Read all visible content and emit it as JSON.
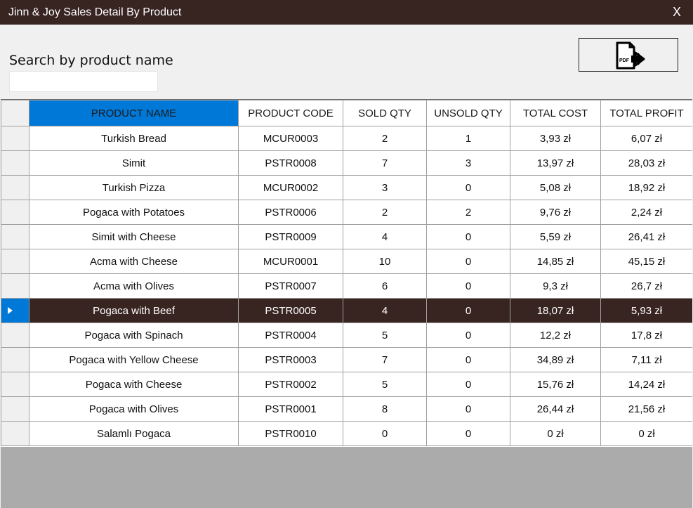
{
  "window": {
    "title": "Jinn & Joy Sales Detail By Product",
    "close_label": "X"
  },
  "search": {
    "label": "Search by product name",
    "value": "",
    "placeholder": ""
  },
  "pdf_button": {
    "icon": "pdf-export-icon",
    "icon_text": "PDF"
  },
  "colors": {
    "titlebar": "#382421",
    "header_selected": "#0078d7",
    "row_selected": "#382421",
    "empty_area": "#ababab"
  },
  "table": {
    "columns": [
      "PRODUCT NAME",
      "PRODUCT CODE",
      "SOLD QTY",
      "UNSOLD QTY",
      "TOTAL COST",
      "TOTAL PROFIT"
    ],
    "selected_row": 7,
    "rows": [
      [
        "Turkish Bread",
        "MCUR0003",
        "2",
        "1",
        "3,93 zł",
        "6,07 zł"
      ],
      [
        "Simit",
        "PSTR0008",
        "7",
        "3",
        "13,97 zł",
        "28,03 zł"
      ],
      [
        "Turkish Pizza",
        "MCUR0002",
        "3",
        "0",
        "5,08 zł",
        "18,92 zł"
      ],
      [
        "Pogaca with Potatoes",
        "PSTR0006",
        "2",
        "2",
        "9,76 zł",
        "2,24 zł"
      ],
      [
        "Simit with Cheese",
        "PSTR0009",
        "4",
        "0",
        "5,59 zł",
        "26,41 zł"
      ],
      [
        "Acma with Cheese",
        "MCUR0001",
        "10",
        "0",
        "14,85 zł",
        "45,15 zł"
      ],
      [
        "Acma with Olives",
        "PSTR0007",
        "6",
        "0",
        "9,3 zł",
        "26,7 zł"
      ],
      [
        "Pogaca with Beef",
        "PSTR0005",
        "4",
        "0",
        "18,07 zł",
        "5,93 zł"
      ],
      [
        "Pogaca with Spinach",
        "PSTR0004",
        "5",
        "0",
        "12,2 zł",
        "17,8 zł"
      ],
      [
        "Pogaca with Yellow Cheese",
        "PSTR0003",
        "7",
        "0",
        "34,89 zł",
        "7,11 zł"
      ],
      [
        "Pogaca with Cheese",
        "PSTR0002",
        "5",
        "0",
        "15,76 zł",
        "14,24 zł"
      ],
      [
        "Pogaca with Olives",
        "PSTR0001",
        "8",
        "0",
        "26,44 zł",
        "21,56 zł"
      ],
      [
        "Salamlı Pogaca",
        "PSTR0010",
        "0",
        "0",
        "0 zł",
        "0 zł"
      ]
    ]
  }
}
